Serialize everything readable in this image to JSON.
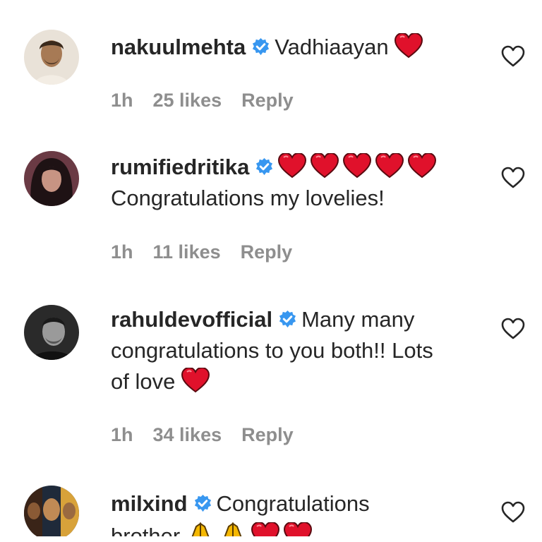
{
  "colors": {
    "verified": "#3897f0",
    "meta": "#8e8e8e",
    "heart": "#e0112b"
  },
  "comments": [
    {
      "username": "nakuulmehta",
      "text": "Vadhiaayan",
      "emojis_after": [
        "red-heart"
      ],
      "time": "1h",
      "likes": "25 likes",
      "reply": "Reply"
    },
    {
      "username": "rumifiedritika",
      "text": "Congratulations my lovelies!",
      "emojis_before_text": [
        "red-heart",
        "red-heart",
        "red-heart",
        "red-heart",
        "red-heart"
      ],
      "time": "1h",
      "likes": "11 likes",
      "reply": "Reply"
    },
    {
      "username": "rahuldevofficial",
      "text_line1": "Many many",
      "text_line2": "congratulations to you both!! Lots",
      "text_line3": "of love",
      "emojis_after": [
        "red-heart"
      ],
      "time": "1h",
      "likes": "34 likes",
      "reply": "Reply"
    },
    {
      "username": "milxind",
      "text_line1": "Congratulations",
      "text_line2": "brother",
      "emojis_after": [
        "folded-hands",
        "folded-hands",
        "red-heart",
        "red-heart"
      ]
    }
  ]
}
